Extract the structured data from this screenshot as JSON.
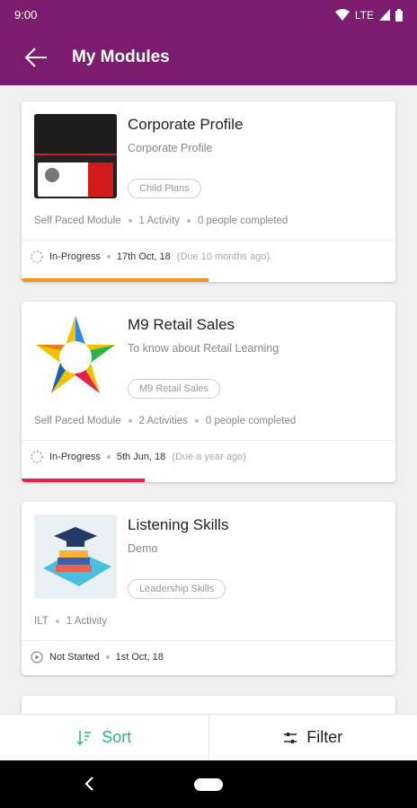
{
  "status_bar": {
    "time": "9:00",
    "network": "LTE"
  },
  "app_bar": {
    "title": "My Modules"
  },
  "modules": [
    {
      "title": "Corporate Profile",
      "subtitle": "Corporate Profile",
      "tag": "Child Plans",
      "type": "Self Paced Module",
      "activities": "1 Activity",
      "completed": "0 people completed",
      "status": "In-Progress",
      "date": "17th Oct, 18",
      "due": "(Due 10 months ago)",
      "progress": 0.5,
      "progress_color": "#f7941d"
    },
    {
      "title": "M9 Retail Sales",
      "subtitle": "To know about Retail Learning",
      "tag": "M9 Retail Sales",
      "type": "Self Paced Module",
      "activities": "2 Activities",
      "completed": "0 people completed",
      "status": "In-Progress",
      "date": "5th Jun, 18",
      "due": "(Due a year ago)",
      "progress": 0.33,
      "progress_color": "#e8204f"
    },
    {
      "title": "Listening Skills",
      "subtitle": "Demo",
      "tag": "Leadership Skills",
      "type": "ILT",
      "activities": "1 Activity",
      "status": "Not Started",
      "date": "1st Oct, 18"
    }
  ],
  "bottom_bar": {
    "sort_label": "Sort",
    "filter_label": "Filter"
  },
  "colors": {
    "brand": "#7b1c6e",
    "sort_accent": "#2bb38b"
  }
}
